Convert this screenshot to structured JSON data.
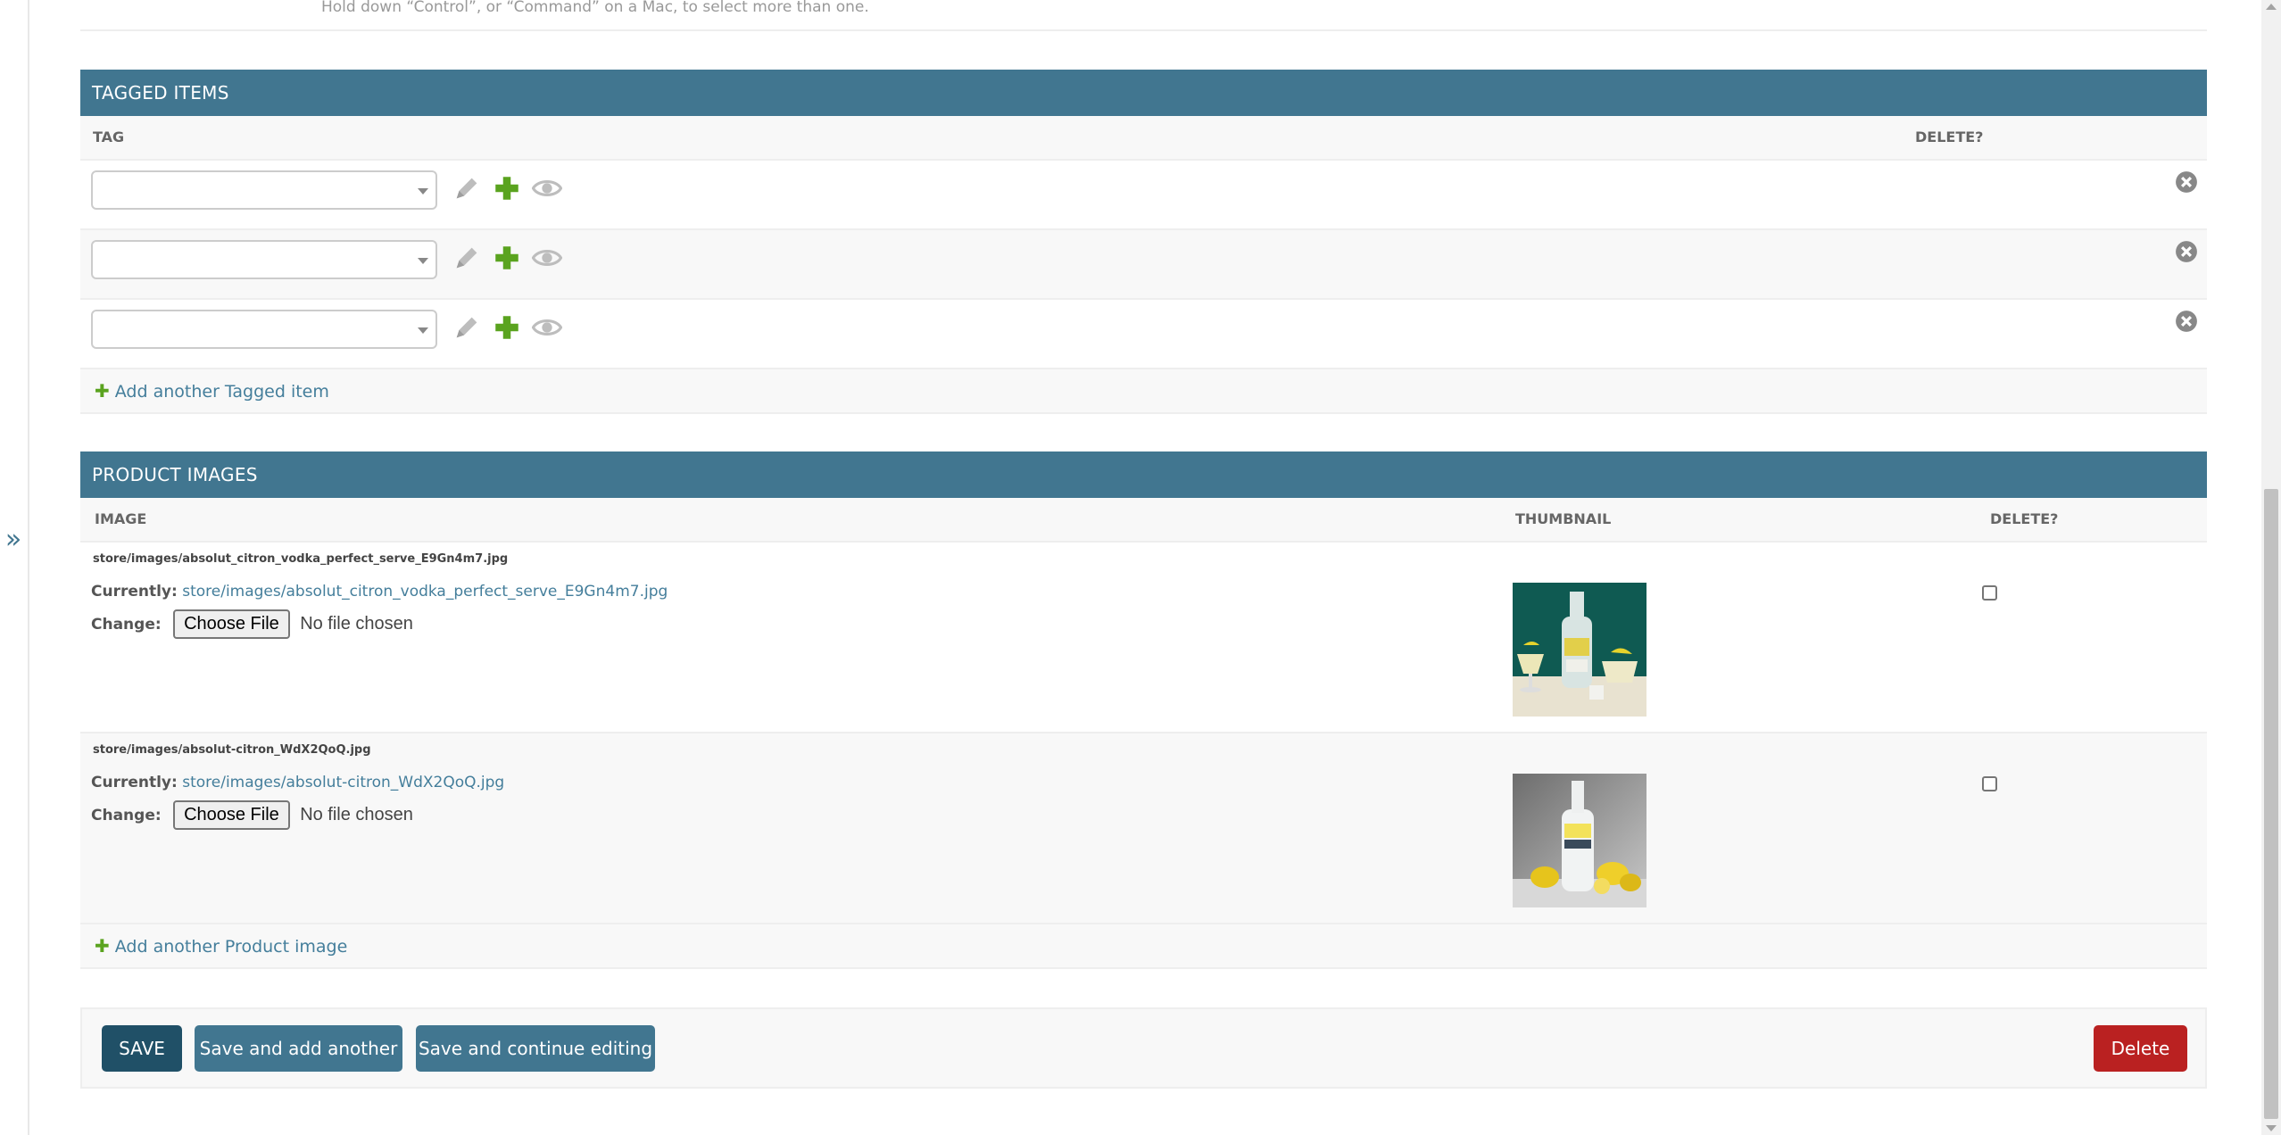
{
  "help_text": "Hold down “Control”, or “Command” on a Mac, to select more than one.",
  "sidebar_toggle": "»",
  "tagged_items": {
    "title": "TAGGED ITEMS",
    "col_tag": "TAG",
    "col_delete": "DELETE?",
    "rows": [
      {
        "selected": ""
      },
      {
        "selected": ""
      },
      {
        "selected": ""
      }
    ],
    "add_label": "Add another Tagged item"
  },
  "product_images": {
    "title": "PRODUCT IMAGES",
    "col_image": "IMAGE",
    "col_thumbnail": "THUMBNAIL",
    "col_delete": "DELETE?",
    "rows": [
      {
        "original": "store/images/absolut_citron_vodka_perfect_serve_E9Gn4m7.jpg",
        "currently_label": "Currently:",
        "currently_link": "store/images/absolut_citron_vodka_perfect_serve_E9Gn4m7.jpg",
        "change_label": "Change:",
        "file_button": "Choose File",
        "file_status": "No file chosen",
        "delete_checked": false
      },
      {
        "original": "store/images/absolut-citron_WdX2QoQ.jpg",
        "currently_label": "Currently:",
        "currently_link": "store/images/absolut-citron_WdX2QoQ.jpg",
        "change_label": "Change:",
        "file_button": "Choose File",
        "file_status": "No file chosen",
        "delete_checked": false
      }
    ],
    "add_label": "Add another Product image"
  },
  "submit": {
    "save": "SAVE",
    "save_add_another": "Save and add another",
    "save_continue": "Save and continue editing",
    "delete": "Delete"
  },
  "colors": {
    "header_bg": "#417690",
    "save_bg": "#205067",
    "delete_bg": "#ba2121",
    "link": "#447e9b",
    "add_icon": "#5aa31f"
  }
}
